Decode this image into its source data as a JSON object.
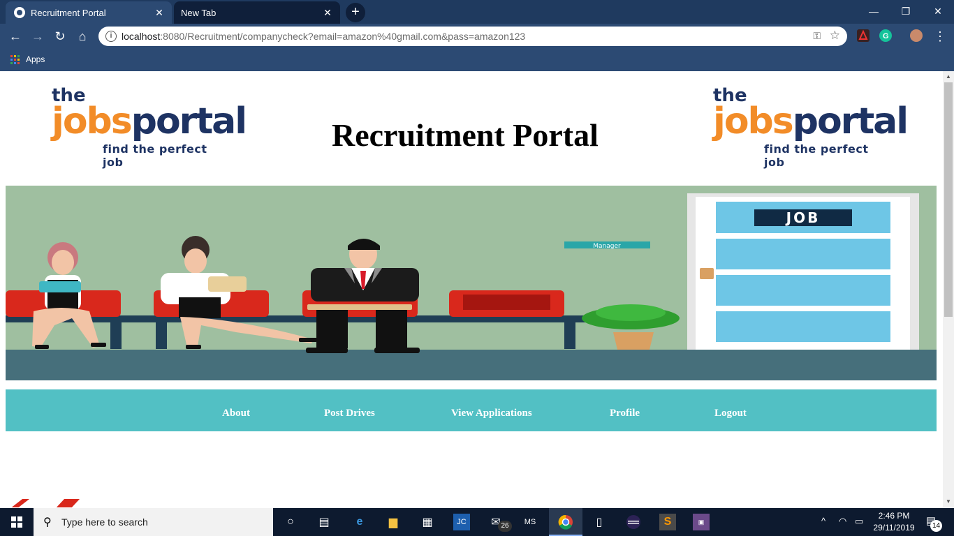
{
  "browser": {
    "tabs": [
      {
        "title": "Recruitment Portal",
        "active": true
      },
      {
        "title": "New Tab",
        "active": false
      }
    ],
    "new_tab_label": "+",
    "url_host": "localhost",
    "url_rest": ":8080/Recruitment/companycheck?email=amazon%40gmail.com&pass=amazon123",
    "bookmarks": {
      "apps_label": "Apps"
    }
  },
  "header": {
    "logo_left": {
      "line1": "the",
      "jobs": "jobs",
      "portal": "portal",
      "tagline": "find the perfect job"
    },
    "logo_right": {
      "line1": "the",
      "jobs": "jobs",
      "portal": "portal",
      "tagline": "find the perfect job"
    },
    "title": "Recruitment Portal"
  },
  "banner": {
    "door_sign": "JOB",
    "manager_sign": "Manager"
  },
  "nav": {
    "items": [
      {
        "label": "About"
      },
      {
        "label": "Post Drives"
      },
      {
        "label": "View Applications"
      },
      {
        "label": "Profile"
      },
      {
        "label": "Logout"
      }
    ]
  },
  "taskbar": {
    "search_placeholder": "Type here to search",
    "mail_badge": "26",
    "time": "2:46 PM",
    "date": "29/11/2019",
    "notifications": "14"
  },
  "colors": {
    "nav_bg": "#52c0c4",
    "logo_orange": "#f28c28",
    "logo_navy": "#1e3363",
    "chrome_bg": "#1f3a5f"
  }
}
